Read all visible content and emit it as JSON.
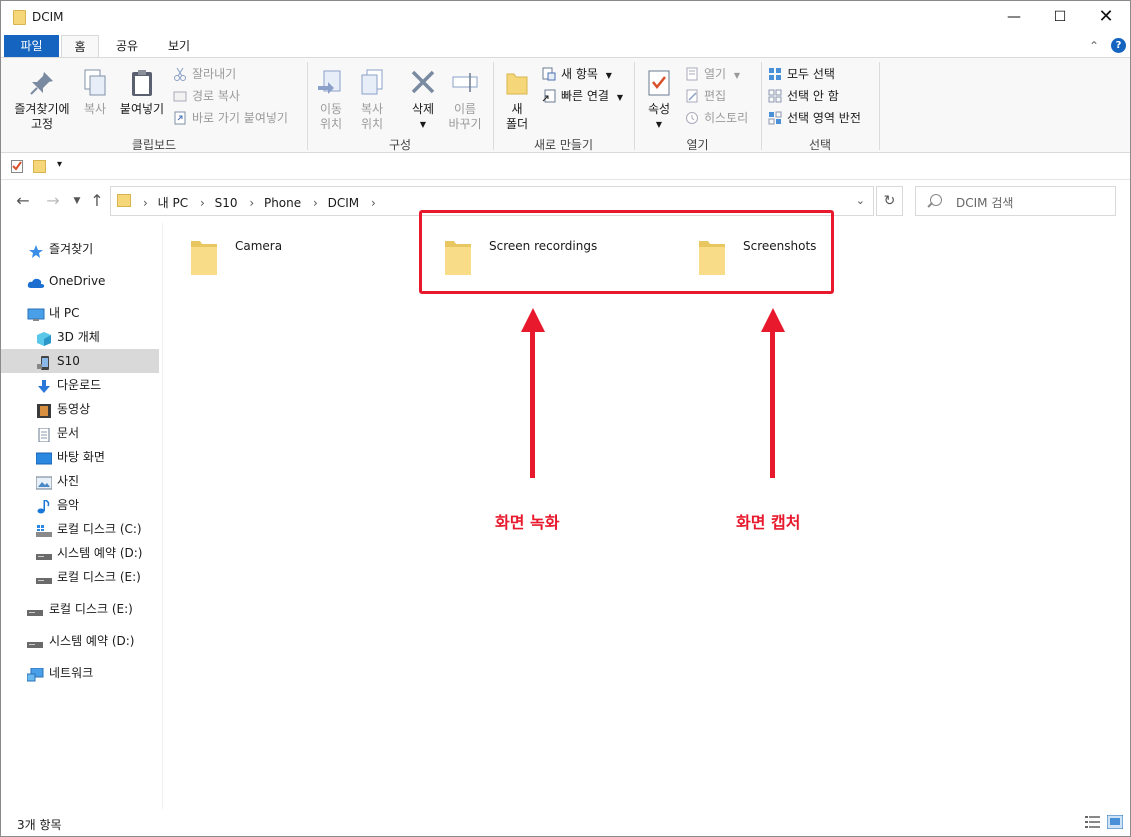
{
  "window": {
    "title": "DCIM"
  },
  "ribbon_tabs": {
    "file": "파일",
    "home": "홈",
    "share": "공유",
    "view": "보기"
  },
  "ribbon": {
    "clipboard": {
      "label": "클립보드",
      "pin_line1": "즐겨찾기에",
      "pin_line2": "고정",
      "copy": "복사",
      "paste": "붙여넣기",
      "cut": "잘라내기",
      "copy_path": "경로 복사",
      "paste_shortcut": "바로 가기 붙여넣기"
    },
    "organize": {
      "label": "구성",
      "move_line1": "이동",
      "move_line2": "위치",
      "copy_line1": "복사",
      "copy_line2": "위치",
      "delete": "삭제",
      "rename_line1": "이름",
      "rename_line2": "바꾸기"
    },
    "new": {
      "label": "새로 만들기",
      "folder_line1": "새",
      "folder_line2": "폴더",
      "new_item": "새 항목",
      "easy_access": "빠른 연결"
    },
    "open": {
      "label": "열기",
      "properties": "속성",
      "open": "열기",
      "edit": "편집",
      "history": "히스토리"
    },
    "select": {
      "label": "선택",
      "select_all": "모두 선택",
      "select_none": "선택 안 함",
      "invert": "선택 영역 반전"
    }
  },
  "address": {
    "crumbs": [
      "내 PC",
      "S10",
      "Phone",
      "DCIM"
    ],
    "search_placeholder": "DCIM 검색"
  },
  "nav": {
    "quick_access": "즐겨찾기",
    "onedrive": "OneDrive",
    "this_pc": "내 PC",
    "objects3d": "3D 개체",
    "s10": "S10",
    "downloads": "다운로드",
    "videos": "동영상",
    "documents": "문서",
    "desktop": "바탕 화면",
    "pictures": "사진",
    "music": "음악",
    "local_c": "로컬 디스크 (C:)",
    "system_d": "시스템 예약 (D:)",
    "local_e": "로컬 디스크 (E:)",
    "local_e2": "로컬 디스크 (E:)",
    "system_d2": "시스템 예약 (D:)",
    "network": "네트워크"
  },
  "folders": [
    "Camera",
    "Screen recordings",
    "Screenshots"
  ],
  "annotations": {
    "recording": "화면 녹화",
    "capture": "화면 캡처"
  },
  "status": {
    "count": "3개 항목"
  },
  "colors": {
    "accent": "#1565c0",
    "annotation": "#e8192c",
    "folder": "#f5d77a"
  }
}
